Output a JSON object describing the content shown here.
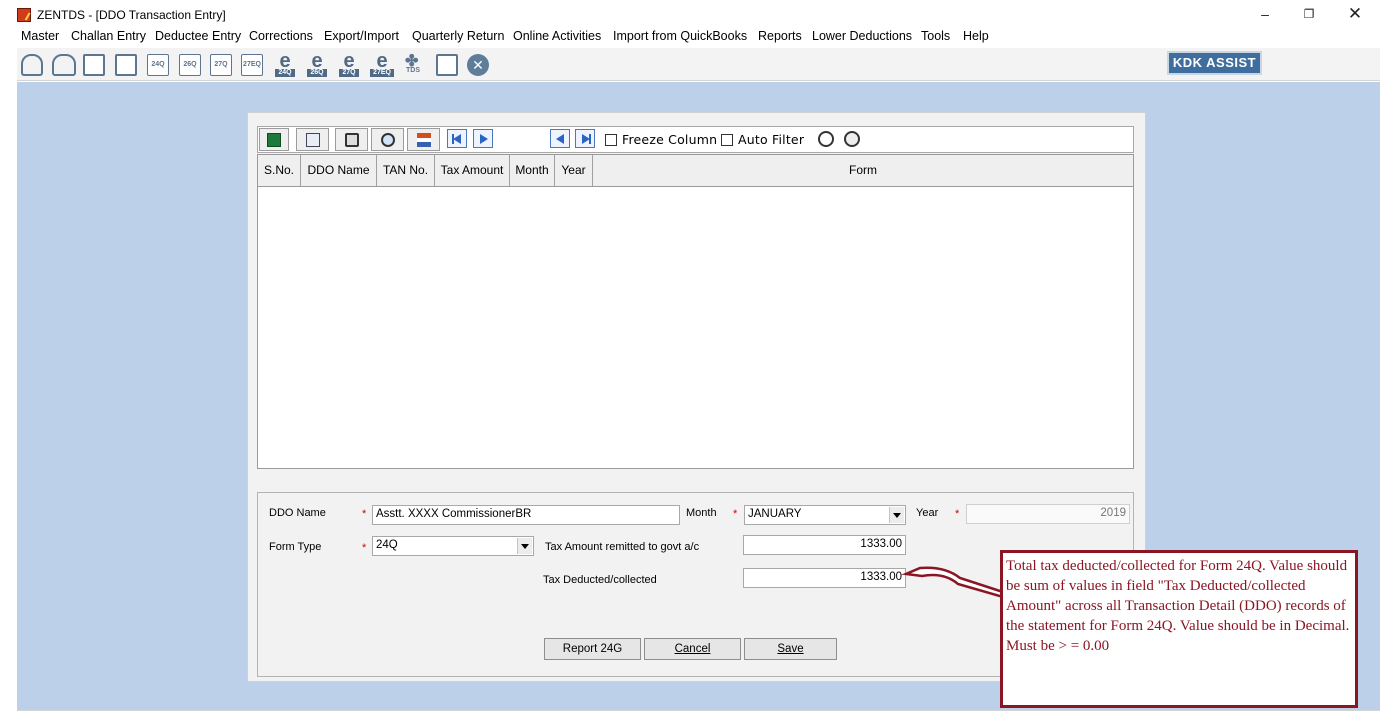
{
  "window": {
    "title": "ZENTDS - [DDO Transaction Entry]",
    "minimize": "–",
    "maximize": "❐",
    "close": "✕"
  },
  "menu": [
    "Master",
    "Challan Entry",
    "Deductee Entry",
    "Corrections",
    "Export/Import",
    "Quarterly Return",
    "Online Activities",
    "Import from QuickBooks",
    "Reports",
    "Lower Deductions",
    "Tools",
    "Help"
  ],
  "toolbar": {
    "icons": [
      "deductor-icon",
      "deductees-icon",
      "user-doc-icon",
      "user-doc-2-icon",
      "form-24q-icon",
      "form-26q-icon",
      "form-27q-icon",
      "form-27eq-icon",
      "e-24q-icon",
      "e-26q-icon",
      "e-27q-icon",
      "e-27eq-icon",
      "tds-icon",
      "pdf-doc-icon",
      "close-circle-icon"
    ],
    "form_labels": [
      "24Q",
      "26Q",
      "27Q",
      "27EQ"
    ],
    "e_labels": [
      "24Q",
      "26Q",
      "27Q",
      "27EQ"
    ],
    "tds_label": "TDS",
    "close_glyph": "✕",
    "kdk_assist": "KDK ASSIST"
  },
  "grid": {
    "freeze_column": "Freeze Column",
    "auto_filter": "Auto Filter",
    "columns": [
      "S.No.",
      "DDO Name",
      "TAN No.",
      "Tax Amount",
      "Month",
      "Year",
      "Form"
    ],
    "rows": []
  },
  "form": {
    "ddo_name_label": "DDO Name",
    "ddo_name_value": "Asstt. XXXX CommissionerBR",
    "month_label": "Month",
    "month_value": "JANUARY",
    "year_label": "Year",
    "year_value": "2019",
    "form_type_label": "Form Type",
    "form_type_value": "24Q",
    "tax_remitted_label": "Tax Amount remitted to govt a/c",
    "tax_remitted_value": "1333.00",
    "tax_deducted_label": "Tax Deducted/collected",
    "tax_deducted_value": "1333.00",
    "required_mark": "*",
    "report_btn": "Report 24G",
    "cancel_btn": "Cancel",
    "save_btn": "Save"
  },
  "callout": {
    "text": "Total tax deducted/collected for Form 24Q. Value should be sum of values in field \"Tax Deducted/collected Amount\" across all Transaction Detail (DDO) records of the statement for Form 24Q. Value should be in Decimal. Must be > = 0.00",
    "color": "#8b1623"
  },
  "colors": {
    "workarea": "#bcd0ea",
    "kdk_button": "#3f6e9e",
    "required": "#d00000"
  }
}
